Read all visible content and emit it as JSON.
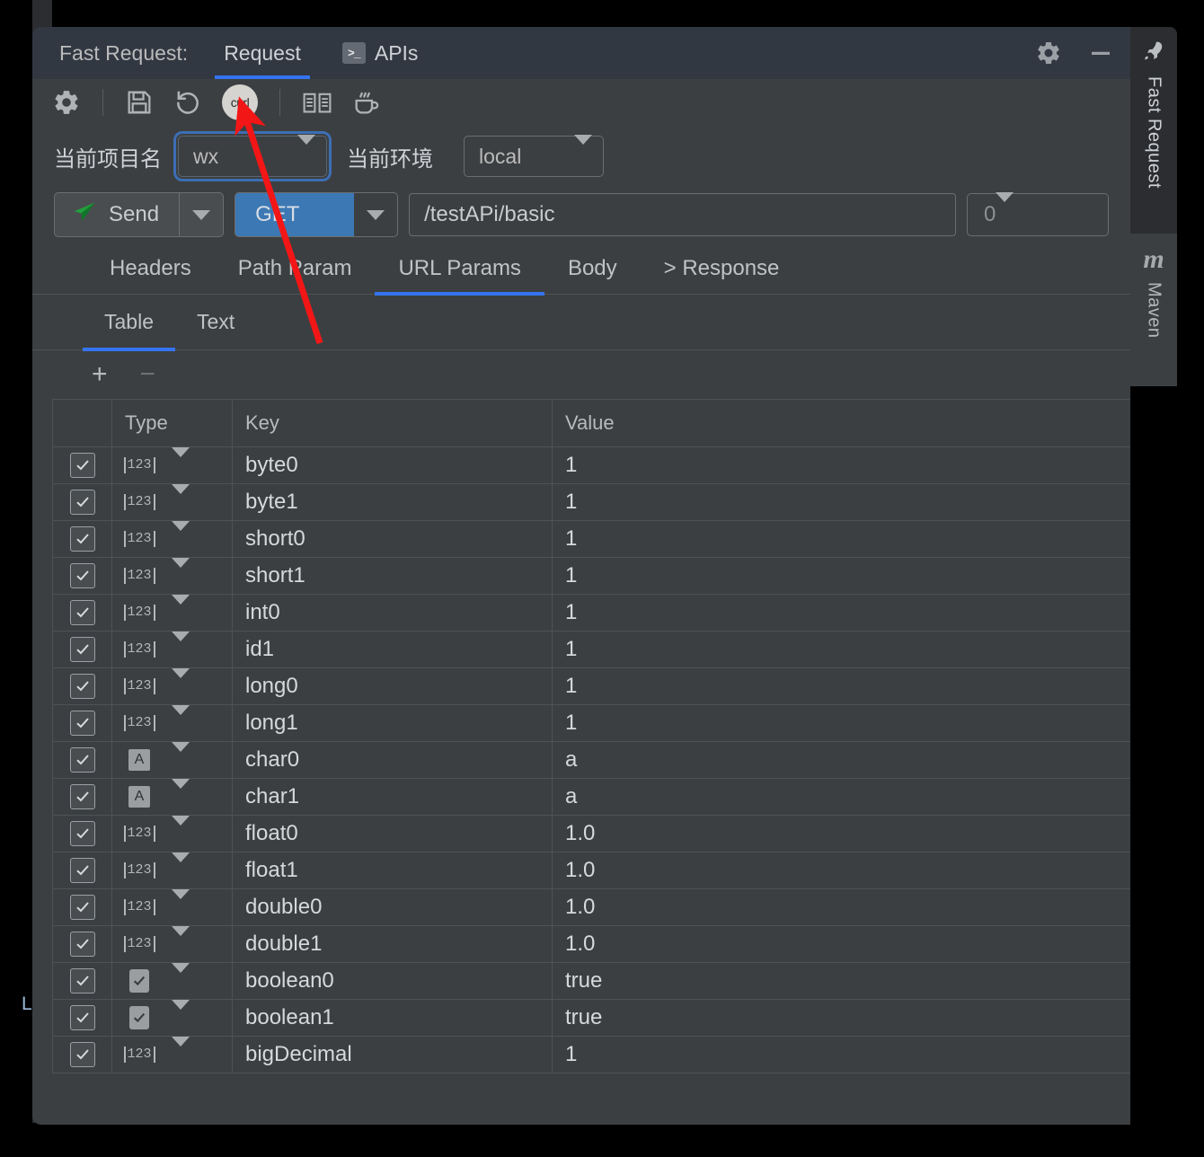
{
  "window": {
    "tool_title": "Fast Request:",
    "tabs": [
      {
        "label": "Request",
        "active": true,
        "icon": ""
      },
      {
        "label": "APIs",
        "active": false,
        "icon": "terminal-icon"
      }
    ],
    "settings_icon": "gear-icon",
    "minimize_icon": "minimize-icon"
  },
  "toolbar": {
    "items": [
      {
        "name": "settings",
        "icon": "gear-icon",
        "label": ""
      },
      {
        "name": "save",
        "icon": "floppy-disk-icon",
        "label": ""
      },
      {
        "name": "reset",
        "icon": "undo-circular-arrow-icon",
        "label": ""
      },
      {
        "name": "curl",
        "icon": "curl-icon",
        "label": "curl"
      },
      {
        "name": "docs",
        "icon": "book-icon",
        "label": ""
      },
      {
        "name": "java",
        "icon": "coffee-cup-icon",
        "label": ""
      }
    ]
  },
  "env": {
    "project_label": "当前项目名",
    "project_value": "wx",
    "environment_label": "当前环境",
    "environment_value": "local"
  },
  "request": {
    "send_label": "Send",
    "send_icon": "paper-plane-icon",
    "method": "GET",
    "url": "/testAPi/basic",
    "count_value": "0"
  },
  "section_tabs": [
    {
      "label": "Headers",
      "active": false
    },
    {
      "label": "Path Param",
      "active": false
    },
    {
      "label": "URL Params",
      "active": true
    },
    {
      "label": "Body",
      "active": false
    },
    {
      "label": "> Response",
      "active": false
    }
  ],
  "view_tabs": [
    {
      "label": "Table",
      "active": true
    },
    {
      "label": "Text",
      "active": false
    }
  ],
  "row_tools": {
    "add_label": "+",
    "remove_label": "−"
  },
  "table": {
    "columns": [
      "",
      "Type",
      "Key",
      "Value"
    ],
    "rows": [
      {
        "checked": true,
        "type_icon": "number-type-icon",
        "key": "byte0",
        "value": "1"
      },
      {
        "checked": true,
        "type_icon": "number-type-icon",
        "key": "byte1",
        "value": "1"
      },
      {
        "checked": true,
        "type_icon": "number-type-icon",
        "key": "short0",
        "value": "1"
      },
      {
        "checked": true,
        "type_icon": "number-type-icon",
        "key": "short1",
        "value": "1"
      },
      {
        "checked": true,
        "type_icon": "number-type-icon",
        "key": "int0",
        "value": "1"
      },
      {
        "checked": true,
        "type_icon": "number-type-icon",
        "key": "id1",
        "value": "1"
      },
      {
        "checked": true,
        "type_icon": "number-type-icon",
        "key": "long0",
        "value": "1"
      },
      {
        "checked": true,
        "type_icon": "number-type-icon",
        "key": "long1",
        "value": "1"
      },
      {
        "checked": true,
        "type_icon": "text-type-icon",
        "key": "char0",
        "value": "a"
      },
      {
        "checked": true,
        "type_icon": "text-type-icon",
        "key": "char1",
        "value": "a"
      },
      {
        "checked": true,
        "type_icon": "number-type-icon",
        "key": "float0",
        "value": "1.0"
      },
      {
        "checked": true,
        "type_icon": "number-type-icon",
        "key": "float1",
        "value": "1.0"
      },
      {
        "checked": true,
        "type_icon": "number-type-icon",
        "key": "double0",
        "value": "1.0"
      },
      {
        "checked": true,
        "type_icon": "number-type-icon",
        "key": "double1",
        "value": "1.0"
      },
      {
        "checked": true,
        "type_icon": "boolean-type-icon",
        "key": "boolean0",
        "value": "true"
      },
      {
        "checked": true,
        "type_icon": "boolean-type-icon",
        "key": "boolean1",
        "value": "true"
      },
      {
        "checked": true,
        "type_icon": "number-type-icon",
        "key": "bigDecimal",
        "value": "1"
      }
    ]
  },
  "right_strip": [
    {
      "label": "Fast Request",
      "icon": "rocket-icon",
      "active": true
    },
    {
      "label": "Maven",
      "icon": "maven-m-icon",
      "active": false
    }
  ],
  "background": {
    "editor_fragment_text": "Le"
  },
  "colors": {
    "accent_blue": "#3574f0",
    "method_blue": "#3c78b4",
    "panel_bg": "#3c3f41",
    "titlebar_bg": "#323842",
    "annotation_red": "#f31616",
    "gutter_marker": "#c8952a"
  }
}
